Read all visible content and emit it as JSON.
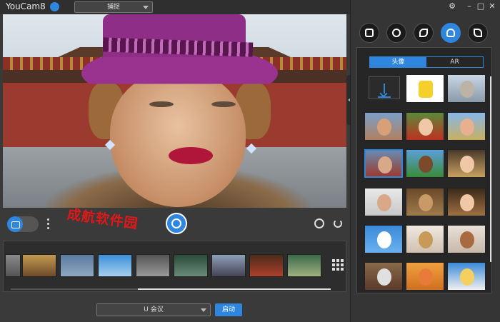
{
  "app": {
    "title": "YouCam8",
    "mode_select": "捕捉"
  },
  "controls": {
    "watermark": "成航软件园"
  },
  "bottom": {
    "mic_select": "U 会议",
    "start_label": "启动"
  },
  "panel": {
    "tabs": [
      {
        "label": "头像"
      },
      {
        "label": "AR"
      }
    ],
    "categories": [
      {
        "name": "frame-icon"
      },
      {
        "name": "emoji-icon"
      },
      {
        "name": "particle-icon"
      },
      {
        "name": "avatar-icon",
        "active": true
      },
      {
        "name": "brush-icon"
      }
    ]
  },
  "colors": {
    "accent": "#2e86de",
    "watermark": "#e01818"
  }
}
